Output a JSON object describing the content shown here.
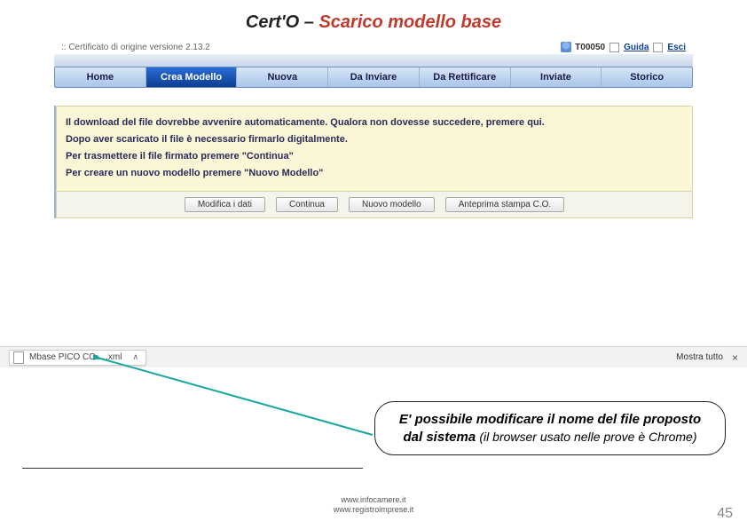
{
  "slide": {
    "title_black": "Cert'O – ",
    "title_red": "Scarico modello base",
    "page_number": "45"
  },
  "topbar": {
    "version": ":: Certificato di origine versione 2.13.2",
    "user_code": "T00050",
    "guida": "Guida",
    "esci": "Esci"
  },
  "menu": {
    "items": [
      "Home",
      "Crea Modello",
      "Nuova",
      "Da Inviare",
      "Da Rettificare",
      "Inviate",
      "Storico"
    ],
    "active_index": 1
  },
  "messages": {
    "line1": "Il download del file dovrebbe avvenire automaticamente. Qualora non dovesse succedere, premere qui.",
    "line2": "Dopo aver scaricato il file è necessario firmarlo digitalmente.",
    "line3": "Per trasmettere il file firmato premere \"Continua\"",
    "line4": "Per creare un nuovo modello premere \"Nuovo Modello\""
  },
  "buttons": {
    "modifica": "Modifica i dati",
    "continua": "Continua",
    "nuovo": "Nuovo modello",
    "anteprima": "Anteprima stampa C.O."
  },
  "download": {
    "filename": "Mbase PICO CO ....xml",
    "mostra_tutto": "Mostra tutto",
    "close": "×"
  },
  "callout": {
    "bold": "E' possibile modificare il nome del file proposto dal sistema ",
    "rest": "(il browser usato nelle prove è Chrome)"
  },
  "footer": {
    "line1": "www.infocamere.it",
    "line2": "www.registroimprese.it"
  }
}
